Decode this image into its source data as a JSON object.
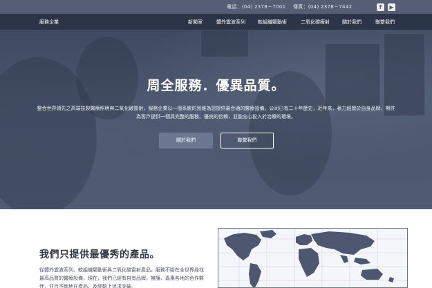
{
  "topbar": {
    "phone": "電話：(04) 2378－7001",
    "fax": "傳真：(04) 2378－7442",
    "social": [
      {
        "icon": "facebook-icon",
        "glyph": "f"
      },
      {
        "icon": "youtube-icon",
        "glyph": "▶"
      }
    ]
  },
  "navbar": {
    "brand": "服務企業",
    "items": [
      "新聞室",
      "體外震波系列",
      "軟組織驅動術",
      "二氧化碳療射",
      "關於我們",
      "聯繫我們"
    ]
  },
  "hero": {
    "title": "周全服務．優異品質。",
    "description": "整合世界領先之高端技製醫療照明與二氧化碳雷射，服務企業以一個系統的思維為您提供最合適的醫療設備。公司已有二十年歷史，近年來，著力經營於自身品牌，期許為客戶提供一個具完整的服務、優良的信賴，並能全心投入於治療的環境。",
    "buttons": {
      "about": "關於我們",
      "contact": "聯繫我們"
    }
  },
  "products": {
    "title": "我們只提供最優秀的產品。",
    "text": "從體外震波系列、軟組織驅動術與二氧化碳雷射產品，服務不斷在全世界尋找最高品質的醫療設備，現在，我們已經有自有品牌，擁護、嘉惠各地的合作夥伴，並且不斷地在產品、及經驗上追求突破。"
  },
  "colors": {
    "topbar": "#565e76",
    "navbar": "#2c3447",
    "hero_overlay": "#4e5870",
    "button_fill": "#6e7791"
  }
}
